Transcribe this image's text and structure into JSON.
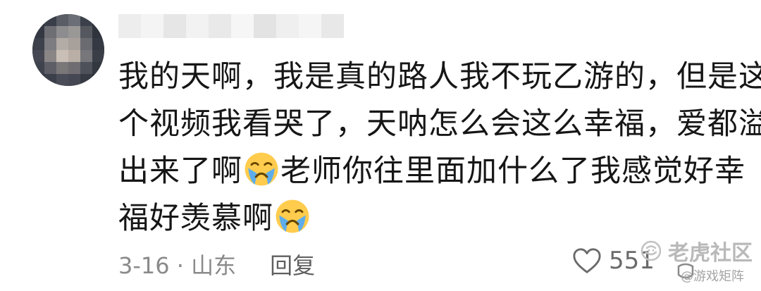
{
  "comment": {
    "lines": [
      "我的天啊，我是真的路人我不玩乙游的，但是这",
      "个视频我看哭了，天呐怎么会这么幸福，爱都溢",
      [
        "出来了啊",
        "老师你往里面加什么了我感觉好幸"
      ],
      [
        "福好羡慕啊"
      ]
    ],
    "line1": "我的天啊，我是真的路人我不玩乙游的，但是这",
    "line2": "个视频我看哭了，天呐怎么会这么幸福，爱都溢",
    "line3_a": "出来了啊",
    "line3_b": "老师你往里面加什么了我感觉好幸",
    "line4_a": "福好羡慕啊",
    "emoji": "crying-face"
  },
  "meta": {
    "date_location": "3-16 · 山东",
    "reply_label": "回复"
  },
  "like": {
    "count": "551"
  },
  "watermark": {
    "main": "老虎社区",
    "sub": "@游戏矩阵"
  },
  "colors": {
    "text": "#161616",
    "meta": "#8a8a8a",
    "emoji_face": "#ffcc4d",
    "emoji_tears": "#5dadec"
  }
}
